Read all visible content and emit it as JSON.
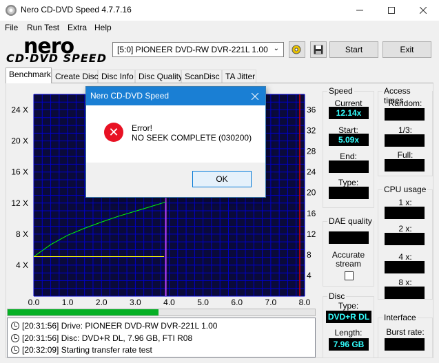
{
  "window": {
    "title": "Nero CD-DVD Speed 4.7.7.16"
  },
  "menu": [
    "File",
    "Run Test",
    "Extra",
    "Help"
  ],
  "logo": {
    "top": "nero",
    "bottom": "CD·DVD SPEED"
  },
  "toolbar": {
    "drive": "[5:0]  PIONEER DVD-RW  DVR-221L 1.00",
    "start_label": "Start",
    "exit_label": "Exit"
  },
  "tabs": [
    "Benchmark",
    "Create Disc",
    "Disc Info",
    "Disc Quality",
    "ScanDisc",
    "TA Jitter"
  ],
  "chart_data": {
    "type": "line",
    "x_ticks": [
      "0.0",
      "1.0",
      "2.0",
      "3.0",
      "4.0",
      "5.0",
      "6.0",
      "7.0",
      "8.0"
    ],
    "y_left_ticks": [
      "4 X",
      "8 X",
      "12 X",
      "16 X",
      "20 X",
      "24 X"
    ],
    "y_right_ticks": [
      "4",
      "8",
      "12",
      "16",
      "20",
      "24",
      "28",
      "32",
      "36"
    ],
    "xlim": [
      0,
      8
    ],
    "ylim": [
      0,
      26
    ],
    "y_right_lim": [
      0,
      39
    ],
    "layer_break_x": 3.9,
    "series": [
      {
        "color": "#00ff00",
        "x": [
          0,
          0.5,
          1.0,
          1.5,
          2.0,
          2.5,
          3.0,
          3.5,
          3.9
        ],
        "y": [
          5.09,
          6.65,
          7.85,
          8.75,
          9.55,
          10.3,
          10.95,
          11.6,
          12.14
        ]
      },
      {
        "color": "#ffff00",
        "x": [
          0,
          1.3,
          3.85
        ],
        "y": [
          5.1,
          5.1,
          5.1
        ]
      }
    ]
  },
  "speed": {
    "title": "Speed",
    "current_label": "Current",
    "current_value": "12.14x",
    "start_label": "Start:",
    "start_value": "5.09x",
    "end_label": "End:",
    "type_label": "Type:"
  },
  "access": {
    "title": "Access times",
    "random_label": "Random:",
    "third_label": "1/3:",
    "full_label": "Full:"
  },
  "cpu": {
    "title": "CPU usage",
    "labels": [
      "1 x:",
      "2 x:",
      "4 x:",
      "8 x:"
    ]
  },
  "dae": {
    "title": "DAE quality",
    "accurate_label_1": "Accurate",
    "accurate_label_2": "stream"
  },
  "disc": {
    "title": "Disc",
    "type_label": "Type:",
    "type_value": "DVD+R DL",
    "length_label": "Length:",
    "length_value": "7.96 GB"
  },
  "interface": {
    "title": "Interface",
    "burst_label": "Burst rate:"
  },
  "progress": {
    "fraction": 0.49
  },
  "log": [
    {
      "time": "[20:31:56]",
      "text": "Drive: PIONEER DVD-RW  DVR-221L 1.00"
    },
    {
      "time": "[20:31:56]",
      "text": "Disc: DVD+R DL, 7.96 GB, FTI R08"
    },
    {
      "time": "[20:32:09]",
      "text": "Starting transfer rate test"
    }
  ],
  "dialog": {
    "title": "Nero CD-DVD Speed",
    "line1": "Error!",
    "line2": "NO SEEK COMPLETE (030200)",
    "ok_label": "OK"
  },
  "colors": {
    "chart_bg": "#0a0a3a",
    "grid": "#0000c8",
    "value_text": "#33ffff",
    "dialog_title": "#1a7fd4",
    "error_icon": "#e81123"
  }
}
